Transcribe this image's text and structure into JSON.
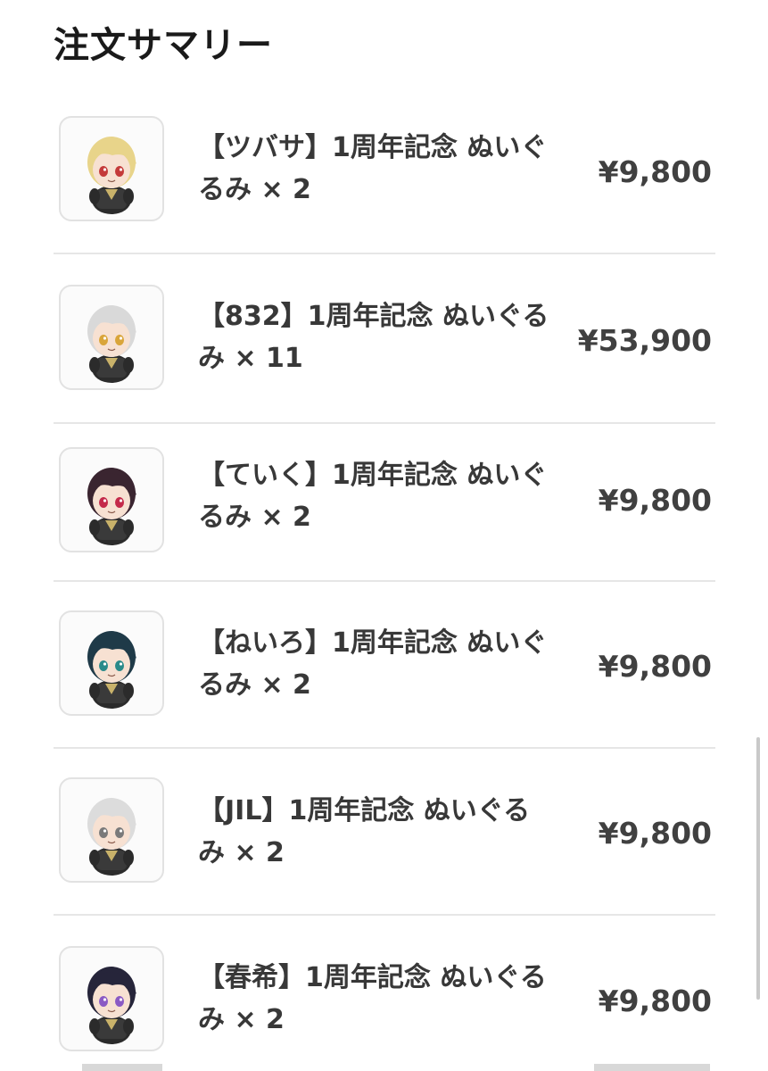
{
  "header": {
    "title": "注文サマリー"
  },
  "items": [
    {
      "name": "【ツバサ】1周年記念 ぬいぐるみ × 2",
      "price": "¥9,800",
      "hair_color": "#e8d48a",
      "eye_color": "#c43a3a"
    },
    {
      "name": "【832】1周年記念 ぬいぐるみ × 11",
      "price": "¥53,900",
      "hair_color": "#d9d9d9",
      "eye_color": "#d9a53a"
    },
    {
      "name": "【ていく】1周年記念 ぬいぐるみ × 2",
      "price": "¥9,800",
      "hair_color": "#3a2530",
      "eye_color": "#c42a4a"
    },
    {
      "name": "【ねいろ】1周年記念 ぬいぐるみ × 2",
      "price": "¥9,800",
      "hair_color": "#1f3a48",
      "eye_color": "#2a8a8a"
    },
    {
      "name": "【JIL】1周年記念 ぬいぐるみ × 2",
      "price": "¥9,800",
      "hair_color": "#dcdcdc",
      "eye_color": "#7a7a7a"
    },
    {
      "name": "【春希】1周年記念 ぬいぐるみ × 2",
      "price": "¥9,800",
      "hair_color": "#26253a",
      "eye_color": "#8a5ac4"
    }
  ]
}
